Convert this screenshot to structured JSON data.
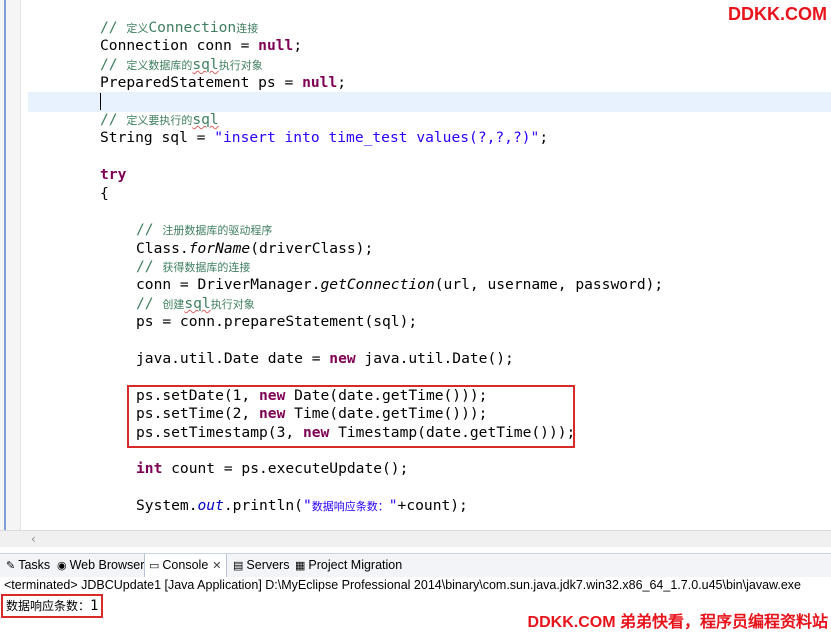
{
  "watermark": {
    "top": "DDKK.COM",
    "bottom": "DDKK.COM 弟弟快看，程序员编程资料站"
  },
  "colors": {
    "keyword": "#7f0055",
    "comment": "#3f7f5f",
    "string": "#2a00ff",
    "highlight_border": "#d92a2a",
    "brand": "#e8141c"
  },
  "code": {
    "l1": {
      "slash": "// ",
      "zh1": "定义",
      "en": "Connection",
      "zh2": "连接"
    },
    "l2": {
      "a": "Connection conn = ",
      "b": "null",
      "c": ";"
    },
    "l3": {
      "slash": "// ",
      "zh1": "定义数据库的",
      "sql": "sql",
      "zh2": "执行对象"
    },
    "l4": {
      "a": "PreparedStatement ps = ",
      "b": "null",
      "c": ";"
    },
    "l6": {
      "slash": "// ",
      "zh1": "定义要执行的",
      "sql": "sql"
    },
    "l7": {
      "a": "String sql = ",
      "b": "\"insert into time_test values(?,?,?)\"",
      "c": ";"
    },
    "l9": {
      "kw": "try"
    },
    "l10": {
      "a": "{"
    },
    "l12": {
      "slash": "// ",
      "zh1": "注册数据库的驱动程序"
    },
    "l13": {
      "a": "Class.",
      "b": "forName",
      "c": "(driverClass);"
    },
    "l14": {
      "slash": "// ",
      "zh1": "获得数据库的连接"
    },
    "l15": {
      "a": "conn = DriverManager.",
      "b": "getConnection",
      "c": "(url, username, password);"
    },
    "l16": {
      "slash": "// ",
      "zh1": "创建",
      "sql": "sql",
      "zh2": "执行对象"
    },
    "l17": {
      "a": "ps = conn.prepareStatement(sql);"
    },
    "l19": {
      "a": "java.util.Date date = ",
      "kw": "new",
      "b": " java.util.Date();"
    },
    "l21": {
      "a": "ps.setDate(1, ",
      "kw": "new",
      "b": " Date(date.getTime()));"
    },
    "l22": {
      "a": "ps.setTime(2, ",
      "kw": "new",
      "b": " Time(date.getTime()));"
    },
    "l23": {
      "a": "ps.setTimestamp(3, ",
      "kw": "new",
      "b": " Timestamp(date.getTime()));"
    },
    "l25": {
      "kw": "int",
      "a": " count = ps.executeUpdate();"
    },
    "l27": {
      "a": "System.",
      "b": "out",
      "c": ".println(",
      "d": "\"",
      "e": "数据响应条数：",
      "f": "\"",
      "g": "+count);"
    }
  },
  "tabs": [
    {
      "label": "Tasks",
      "icon": "tasks-icon"
    },
    {
      "label": "Web Browser",
      "icon": "globe-icon"
    },
    {
      "label": "Console",
      "icon": "console-icon",
      "active": true
    },
    {
      "label": "Servers",
      "icon": "servers-icon"
    },
    {
      "label": "Project Migration",
      "icon": "migration-icon"
    }
  ],
  "console": {
    "terminated": "<terminated> JDBCUpdate1 [Java Application] D:\\MyEclipse Professional 2014\\binary\\com.sun.java.jdk7.win32.x86_64_1.7.0.u45\\bin\\javaw.exe",
    "output_label": "数据响应条数：",
    "output_value": "1"
  }
}
